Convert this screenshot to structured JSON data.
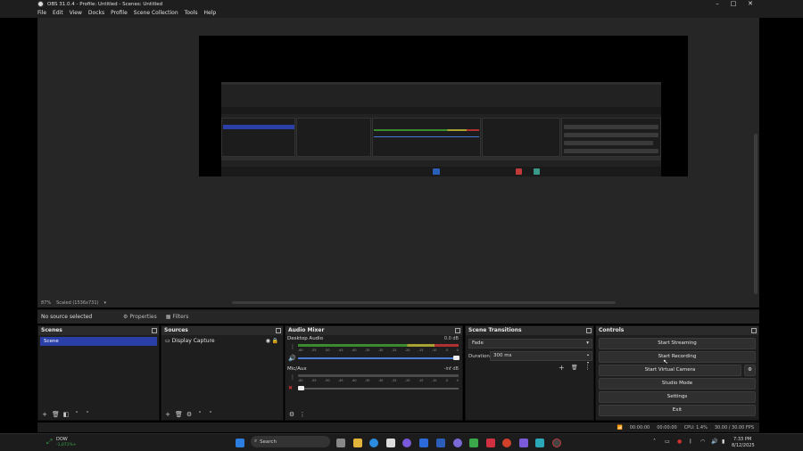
{
  "window": {
    "title": "OBS 31.0.4 - Profile: Untitled - Scenes: Untitled"
  },
  "menu": [
    "File",
    "Edit",
    "View",
    "Docks",
    "Profile",
    "Scene Collection",
    "Tools",
    "Help"
  ],
  "preview": {
    "zoom": "87%",
    "scale_label": "Scaled (1536x731)"
  },
  "source_bar": {
    "no_source": "No source selected",
    "properties": "Properties",
    "filters": "Filters"
  },
  "scenes": {
    "title": "Scenes",
    "items": [
      "Scene"
    ]
  },
  "sources": {
    "title": "Sources",
    "items": [
      "Display Capture"
    ]
  },
  "mixer": {
    "title": "Audio Mixer",
    "channels": [
      {
        "name": "Desktop Audio",
        "db": "0.0 dB",
        "level": 1.0
      },
      {
        "name": "Mic/Aux",
        "db": "-inf dB",
        "level": 0.0
      }
    ],
    "ticks": [
      "-60",
      "-55",
      "-50",
      "-45",
      "-40",
      "-35",
      "-30",
      "-25",
      "-20",
      "-15",
      "-10",
      "-5",
      "0"
    ]
  },
  "transitions": {
    "title": "Scene Transitions",
    "selected": "Fade",
    "duration_label": "Duration",
    "duration_value": "300 ms"
  },
  "controls": {
    "title": "Controls",
    "buttons": [
      "Start Streaming",
      "Start Recording",
      "Start Virtual Camera",
      "Studio Mode",
      "Settings",
      "Exit"
    ]
  },
  "status": {
    "rec_time": "00:00:00",
    "stream_time": "00:00:00",
    "cpu": "CPU: 1.4%",
    "fps": "30.00 / 30.00 FPS"
  },
  "taskbar": {
    "ticker_name": "DOW",
    "ticker_value": "-1,071%+",
    "search_placeholder": "Search",
    "time": "7:33 PM",
    "date": "8/12/2025"
  },
  "colors": {
    "accent": "#2a3fa8",
    "meter_green": "#3a8a2e",
    "meter_yellow": "#a8a232",
    "meter_red": "#b03030"
  }
}
